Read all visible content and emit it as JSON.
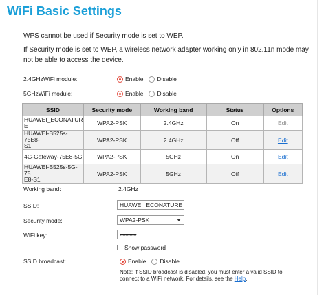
{
  "page": {
    "title": "WiFi Basic Settings"
  },
  "notes": {
    "wps": "WPS cannot be used if Security mode is set to WEP.",
    "wep_line1": "If Security mode is set to WEP, a wireless network adapter working only in 802.11n mode may",
    "wep_line2": "not be able to access the device."
  },
  "modules": [
    {
      "label": "2.4GHzWiFi module:",
      "enable": "Enable",
      "disable": "Disable",
      "selected": "Enable"
    },
    {
      "label": "5GHzWiFi module:",
      "enable": "Enable",
      "disable": "Disable",
      "selected": "Enable"
    }
  ],
  "ssid_table": {
    "headers": [
      "SSID",
      "Security mode",
      "Working band",
      "Status",
      "Options"
    ],
    "rows": [
      {
        "ssid_l1": "HUAWEI_ECONATUR",
        "ssid_l2": "E",
        "security": "WPA2-PSK",
        "band": "2.4GHz",
        "status": "On",
        "option": "Edit",
        "option_enabled": false
      },
      {
        "ssid_l1": "HUAWEI-B525s-75E8-",
        "ssid_l2": "S1",
        "security": "WPA2-PSK",
        "band": "2.4GHz",
        "status": "Off",
        "option": "Edit",
        "option_enabled": true
      },
      {
        "ssid_l1": "4G-Gateway-75E8-5G",
        "ssid_l2": "",
        "security": "WPA2-PSK",
        "band": "5GHz",
        "status": "On",
        "option": "Edit",
        "option_enabled": true
      },
      {
        "ssid_l1": "HUAWEI-B525s-5G-75",
        "ssid_l2": "E8-S1",
        "security": "WPA2-PSK",
        "band": "5GHz",
        "status": "Off",
        "option": "Edit",
        "option_enabled": true
      }
    ]
  },
  "form": {
    "working_band_label": "Working band:",
    "working_band_value": "2.4GHz",
    "ssid_label": "SSID:",
    "ssid_value": "HUAWEI_ECONATURE",
    "security_label": "Security mode:",
    "security_value": "WPA2-PSK",
    "wifi_key_label": "WiFi key:",
    "wifi_key_value": "••••••••••••",
    "show_password": "Show password",
    "broadcast_label": "SSID broadcast:",
    "broadcast_enable": "Enable",
    "broadcast_disable": "Disable",
    "broadcast_selected": "Enable",
    "note_line1": "Note: If SSID broadcast is disabled, you must enter a valid SSID to",
    "note_line2_prefix": "connect to a WiFi network. For details, see the ",
    "note_link": "Help",
    "note_suffix": "."
  },
  "colors": {
    "title": "#1a9fd8",
    "radio_selected": "#e2483a",
    "link": "#1a6fd0",
    "table_header": "#cfcfcf"
  }
}
